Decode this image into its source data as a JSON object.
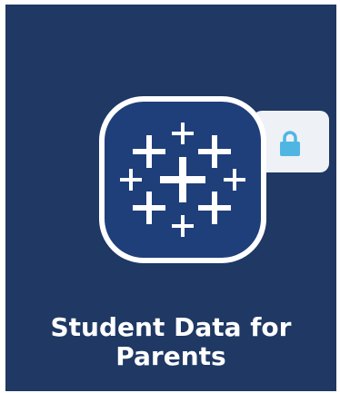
{
  "app_tile": {
    "name": "Student Data for\nParents",
    "icon": "tableau-logo-icon",
    "badge_icon": "lock-icon",
    "colors": {
      "background": "#1f3864",
      "icon_fill": "#1f3f7a",
      "icon_border": "#ffffff",
      "lock": "#4fb6e3",
      "badge": "#eef1f5"
    }
  }
}
